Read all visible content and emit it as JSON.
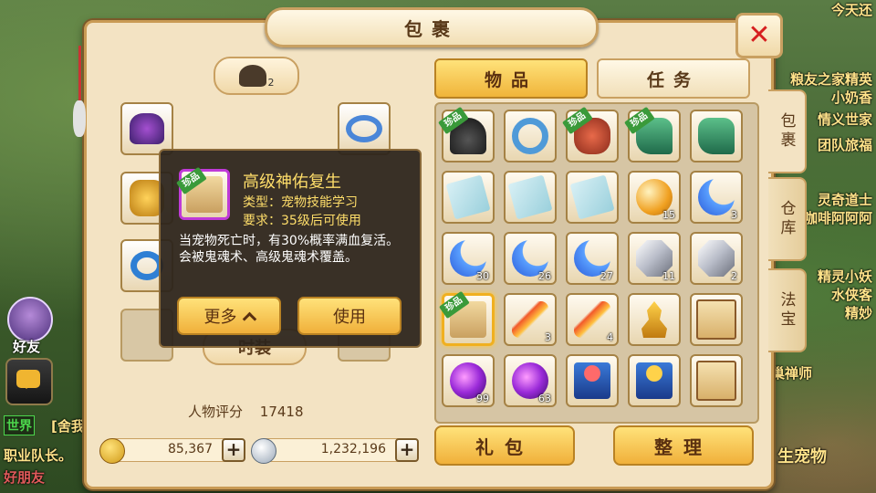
{
  "window": {
    "title": "包裹"
  },
  "background": {
    "right_labels": [
      "今天还",
      "粮友之家精英",
      "小奶香",
      "情义世家",
      "团队旅福",
      "灵奇道士",
      "咖啡阿阿阿",
      "精灵小妖",
      "水侠客",
      "精妙",
      "乌巢禅师",
      "生宠物"
    ],
    "left_labels": [
      "好友",
      "世界",
      "[舍我",
      "职业队长。",
      "好朋友"
    ]
  },
  "equipment": {
    "head_tab_count": "2",
    "fashion_tab": "时装",
    "score_label": "人物评分",
    "score_value": "17418"
  },
  "currency": {
    "gold": "85,367",
    "silver": "1,232,196"
  },
  "tabs": {
    "items": "物品",
    "quests": "任务"
  },
  "side_tabs": [
    "包裹",
    "仓库",
    "法宝"
  ],
  "buttons": {
    "gift": "礼包",
    "sort": "整理"
  },
  "rare_badge": "珍品",
  "inventory": [
    {
      "icon": "black-hat-icon",
      "rare": true,
      "count": ""
    },
    {
      "icon": "blue-necklace-icon",
      "rare": false,
      "count": ""
    },
    {
      "icon": "red-mask-icon",
      "rare": true,
      "count": ""
    },
    {
      "icon": "green-boots-icon",
      "rare": true,
      "count": ""
    },
    {
      "icon": "green-boots-icon",
      "rare": false,
      "count": ""
    },
    {
      "icon": "skill-book-icon",
      "rare": false,
      "count": ""
    },
    {
      "icon": "skill-book-icon",
      "rare": false,
      "count": ""
    },
    {
      "icon": "skill-book-icon",
      "rare": false,
      "count": ""
    },
    {
      "icon": "golden-orb-icon",
      "rare": false,
      "count": "15"
    },
    {
      "icon": "blue-moon-icon",
      "rare": false,
      "count": "3"
    },
    {
      "icon": "blue-moon-icon",
      "rare": false,
      "count": "30"
    },
    {
      "icon": "blue-moon-icon",
      "rare": false,
      "count": "26"
    },
    {
      "icon": "blue-moon-icon",
      "rare": false,
      "count": "27"
    },
    {
      "icon": "silver-gem-icon",
      "rare": false,
      "count": "11"
    },
    {
      "icon": "silver-gem-icon",
      "rare": false,
      "count": "2"
    },
    {
      "icon": "scroll-icon",
      "rare": true,
      "count": "",
      "selected": true
    },
    {
      "icon": "fire-sword-icon",
      "rare": false,
      "count": "3"
    },
    {
      "icon": "fire-sword-icon",
      "rare": false,
      "count": "4"
    },
    {
      "icon": "golden-pagoda-icon",
      "rare": false,
      "count": ""
    },
    {
      "icon": "map-scroll-icon",
      "rare": false,
      "count": ""
    },
    {
      "icon": "purple-orb-icon",
      "rare": false,
      "count": "99"
    },
    {
      "icon": "purple-orb-icon",
      "rare": false,
      "count": "63"
    },
    {
      "icon": "red-treasure-box-icon",
      "rare": false,
      "count": ""
    },
    {
      "icon": "gold-treasure-box-icon",
      "rare": false,
      "count": ""
    },
    {
      "icon": "open-map-icon",
      "rare": false,
      "count": ""
    }
  ],
  "tooltip": {
    "name": "高级神佑复生",
    "type": "类型：宠物技能学习",
    "requirement": "要求：35级后可使用",
    "description": "当宠物死亡时，有30%概率满血复活。会被鬼魂术、高级鬼魂术覆盖。",
    "more_button": "更多",
    "use_button": "使用"
  }
}
